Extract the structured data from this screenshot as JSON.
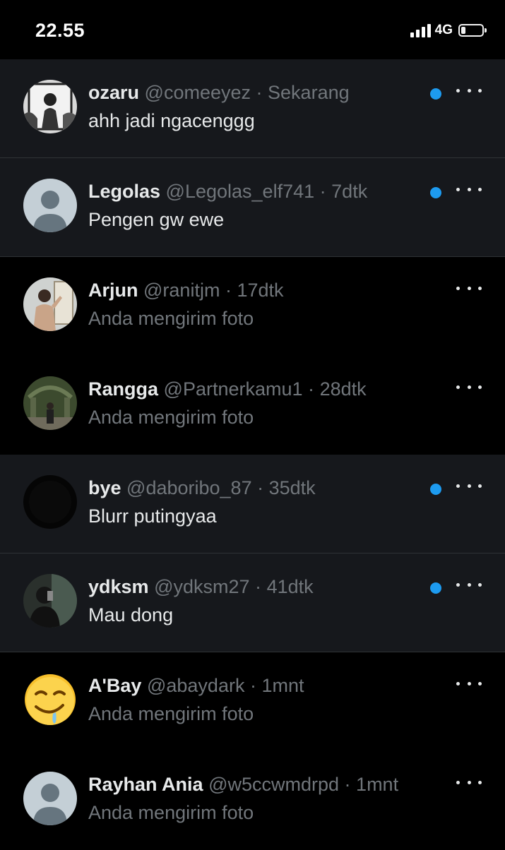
{
  "status_bar": {
    "time": "22.55",
    "network": "4G",
    "battery_level": 0.2
  },
  "colors": {
    "unread_background": "#16181c",
    "accent": "#1d9bf0",
    "muted_text": "#71767b"
  },
  "conversations": [
    {
      "name": "ozaru",
      "handle": "@comeeyez",
      "time": "Sekarang",
      "preview": "ahh jadi ngacenggg",
      "unread": true,
      "avatar": "photo-avatar"
    },
    {
      "name": "Legolas",
      "handle": "@Legolas_elf741",
      "time": "7dtk",
      "preview": "Pengen gw ewe",
      "unread": true,
      "avatar": "default-avatar"
    },
    {
      "name": "Arjun",
      "handle": "@ranitjm",
      "time": "17dtk",
      "preview": "Anda mengirim foto",
      "unread": false,
      "avatar": "photo-avatar"
    },
    {
      "name": "Rangga",
      "handle": "@Partnerkamu1",
      "time": "28dtk",
      "preview": "Anda mengirim foto",
      "unread": false,
      "avatar": "photo-avatar"
    },
    {
      "name": "bye",
      "handle": "@daboribo_87",
      "time": "35dtk",
      "preview": "Blurr putingyaa",
      "unread": true,
      "avatar": "dark-avatar"
    },
    {
      "name": "ydksm",
      "handle": "@ydksm27",
      "time": "41dtk",
      "preview": "Mau dong",
      "unread": true,
      "avatar": "photo-avatar"
    },
    {
      "name": "A'Bay",
      "handle": "@abaydark",
      "time": "1mnt",
      "preview": "Anda mengirim foto",
      "unread": false,
      "avatar": "emoji-avatar"
    },
    {
      "name": "Rayhan Ania",
      "handle": "@w5ccwmdrpd",
      "time": "1mnt",
      "preview": "Anda mengirim foto",
      "unread": false,
      "avatar": "default-avatar"
    }
  ]
}
